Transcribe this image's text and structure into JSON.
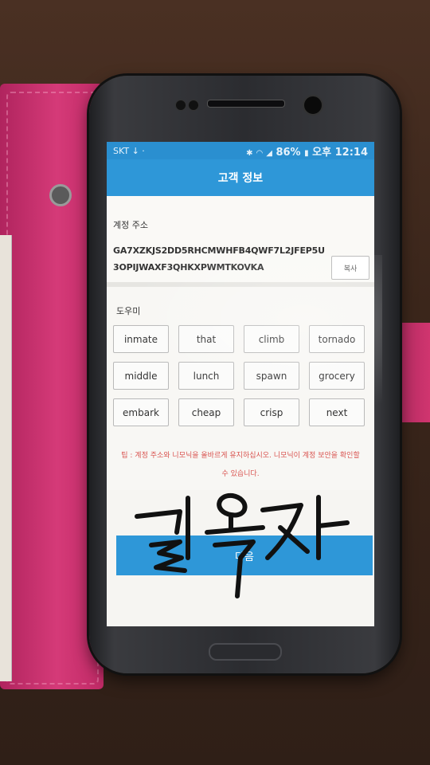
{
  "status_bar": {
    "carrier": "SKT",
    "battery": "86%",
    "time": "오후 12:14"
  },
  "app_bar": {
    "title": "고객 정보"
  },
  "account": {
    "label": "계정 주소",
    "address": "GA7XZKJS2DD5RHCMWHFB4QWF7L2JFEP5U3OPIJWAXF3QHKXPWMTKOVKA",
    "copy_label": "복사"
  },
  "mnemonic": {
    "label": "도우미",
    "words": [
      "inmate",
      "that",
      "climb",
      "tornado",
      "middle",
      "lunch",
      "spawn",
      "grocery",
      "embark",
      "cheap",
      "crisp",
      "next"
    ]
  },
  "tip": "팁 : 계정 주소와 니모닉을 올바르게 유지하십시오. 니모닉이 계정 보안을 확인할 수 있습니다.",
  "next_button": {
    "label": "다음"
  },
  "handwriting": "길옥자",
  "colors": {
    "primary": "#2e97d8",
    "status_bar": "#2a8fd0",
    "tip_text": "#d9534f",
    "case_pink": "#d53a78"
  }
}
